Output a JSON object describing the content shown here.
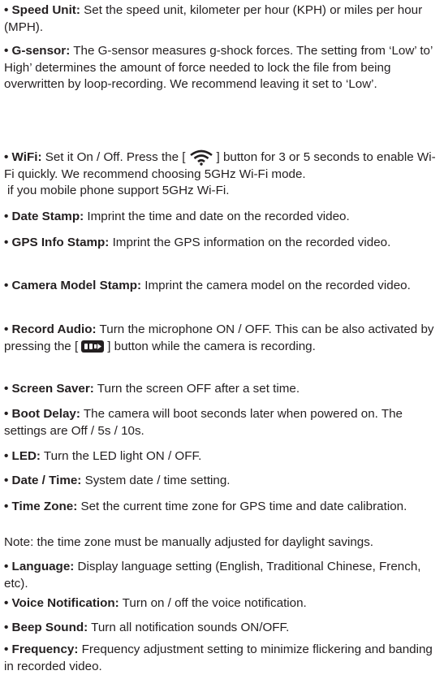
{
  "items": {
    "speed_unit": {
      "label": "• Speed Unit:",
      "text": " Set the speed unit, kilometer per hour (KPH) or miles per hour (MPH)."
    },
    "g_sensor": {
      "label": "• G-sensor:",
      "text": " The G-sensor measures g-shock forces. The setting from ‘Low’ to’ High’ determines the amount of force needed to lock the file from being overwritten by loop-recording. We recommend leaving it set to ‘Low’."
    },
    "wifi": {
      "label": "• WiFi:",
      "text_a": " Set it On / Off. Press the [",
      "text_b": "] button for 3 or 5 seconds to enable Wi-Fi quickly. We recommend choosing 5GHz Wi-Fi mode.",
      "text_c": "if you mobile phone support 5GHz Wi-Fi."
    },
    "date_stamp": {
      "label": "• Date Stamp:",
      "text": " Imprint the time and date on the recorded video."
    },
    "gps_info_stamp": {
      "label": "• GPS Info Stamp:",
      "text": " Imprint the GPS information on the recorded video."
    },
    "camera_model_stamp": {
      "label": "• Camera Model Stamp:",
      "text": " Imprint the camera model on the recorded video."
    },
    "record_audio": {
      "label": "• Record Audio:",
      "text_a": " Turn the microphone ON / OFF. This can be also activated by pressing the [",
      "text_b": "] button while the camera is recording."
    },
    "screen_saver": {
      "label": "• Screen Saver:",
      "text": " Turn the screen OFF after a set time."
    },
    "boot_delay": {
      "label": "• Boot Delay:",
      "text": " The camera will boot seconds later when powered on. The settings are Off / 5s / 10s."
    },
    "led": {
      "label": "• LED:",
      "text": " Turn the LED light ON / OFF."
    },
    "date_time": {
      "label": "• Date / Time:",
      "text": " System date / time setting."
    },
    "time_zone": {
      "label": "• Time Zone:",
      "text": " Set the current time zone for GPS time and date calibration."
    },
    "note": {
      "text": "Note: the time zone must be manually adjusted for daylight savings."
    },
    "language": {
      "label": "• Language:",
      "text": " Display language setting (English, Traditional Chinese, French, etc)."
    },
    "voice_notification": {
      "label": "• Voice Notification:",
      "text": " Turn on / off the voice notification."
    },
    "beep_sound": {
      "label": "• Beep Sound:",
      "text": " Turn all notification sounds ON/OFF."
    },
    "frequency": {
      "label": "• Frequency:",
      "text": " Frequency adjustment setting to minimize flickering and banding in recorded video."
    }
  },
  "icons": {
    "wifi": "wifi-icon",
    "mic": "mic-record-icon"
  }
}
